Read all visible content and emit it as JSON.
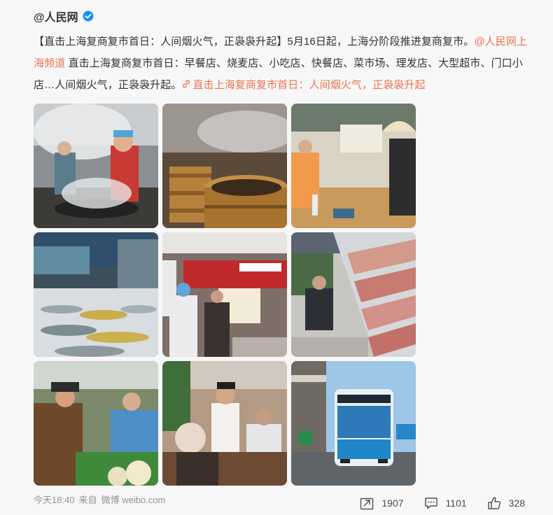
{
  "post": {
    "author": "@人民网",
    "text_before": "【直击上海复商复市首日：人间烟火气，正袅袅升起】5月16日起，上海分阶段推进复商复市。",
    "mention": "@人民网上海频道",
    "text_after": " 直击上海复商复市首日：早餐店、烧麦店、小吃店、快餐店、菜市场、理发店、大型超市、门口小店…人间烟火气，正袅袅升起。",
    "link_text": "直击上海复商复市首日：人间烟火气，正袅袅升起",
    "photos": [
      {
        "label": "steaming-kitchen-cook"
      },
      {
        "label": "bamboo-steamers"
      },
      {
        "label": "breakfast-shop-counter"
      },
      {
        "label": "fish-market-stall"
      },
      {
        "label": "supermarket-butchery"
      },
      {
        "label": "meat-shelf-shopper"
      },
      {
        "label": "vegetable-market-vendor"
      },
      {
        "label": "barber-shop"
      },
      {
        "label": "city-bus-stop"
      }
    ]
  },
  "footer": {
    "time": "今天18:40",
    "source_prefix": "来自",
    "source": "微博 weibo.com",
    "repost_count": "1907",
    "comment_count": "1101",
    "like_count": "328"
  },
  "colors": {
    "accent": "#eb7350",
    "verified": "#1890ff",
    "meta": "#939393"
  },
  "icons": [
    "verified-icon",
    "link-icon",
    "repost-icon",
    "comment-icon",
    "like-icon"
  ]
}
